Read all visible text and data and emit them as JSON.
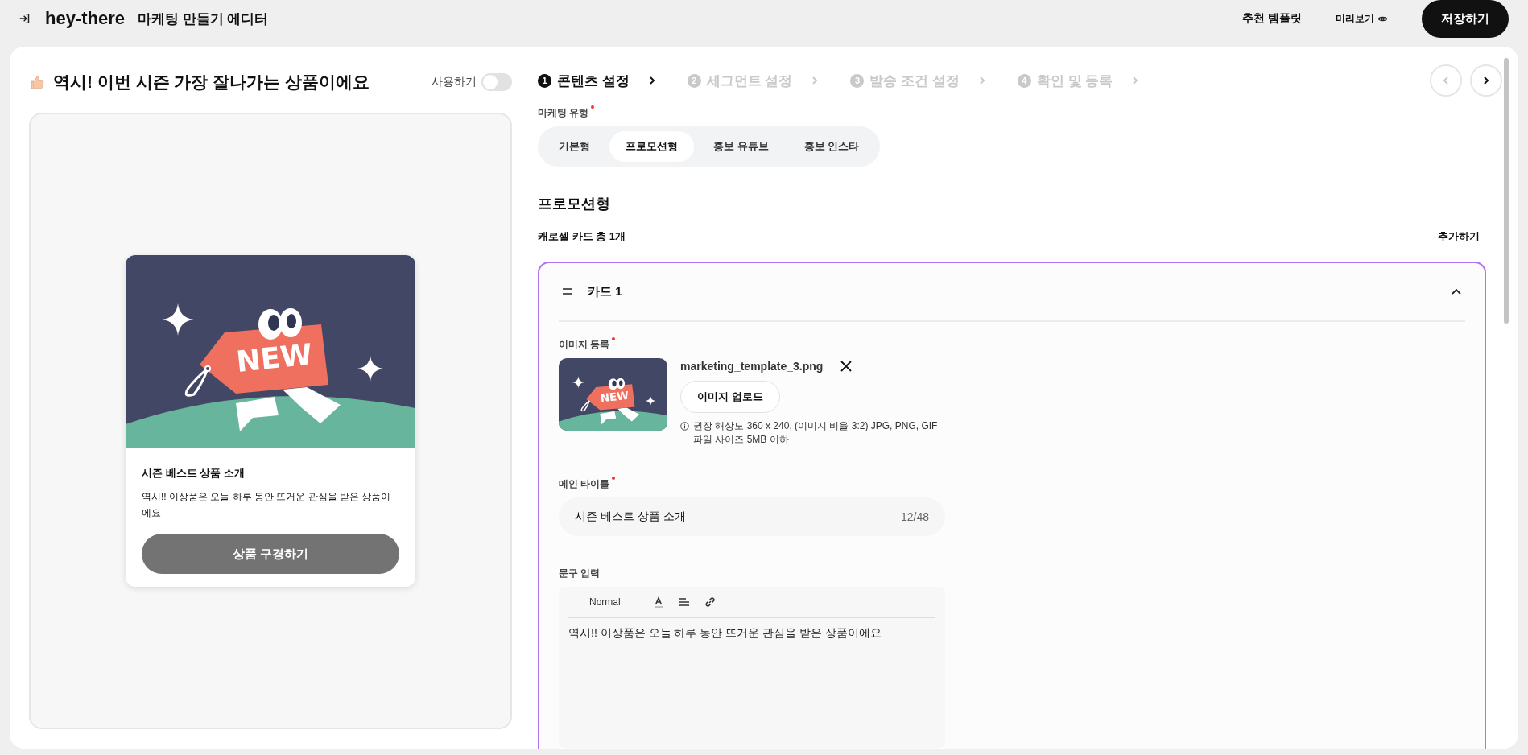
{
  "app": {
    "name": "hey-there",
    "subtitle": "마케팅 만들기 에디터"
  },
  "header_actions": {
    "templates": "추천 템플릿",
    "preview": "미리보기",
    "save": "저장하기"
  },
  "preview_panel": {
    "title": "역시! 이번 시즌 가장 잘나가는 상품이에요",
    "toggle_label": "사용하기",
    "toggle_on": false,
    "card": {
      "artwork_text": "NEW",
      "title": "시즌 베스트 상품 소개",
      "body": "역시!! 이상품은 오늘 하루 동안 뜨거운 관심을 받은 상품이에요",
      "button": "상품 구경하기"
    }
  },
  "steps": [
    {
      "number": "1",
      "label": "콘텐츠 설정",
      "selected": true
    },
    {
      "number": "2",
      "label": "세그먼트 설정",
      "selected": false
    },
    {
      "number": "3",
      "label": "발송 조건 설정",
      "selected": false
    },
    {
      "number": "4",
      "label": "확인 및 등록",
      "selected": false
    }
  ],
  "step_nav": {
    "prev_disabled": true,
    "next_disabled": false
  },
  "marketing_type": {
    "label": "마케팅 유형",
    "required": true,
    "options": [
      {
        "label": "기본형",
        "selected": false
      },
      {
        "label": "프로모션형",
        "selected": true
      },
      {
        "label": "홍보 유튜브",
        "selected": false
      },
      {
        "label": "홍보 인스타",
        "selected": false
      }
    ]
  },
  "section_title": "프로모션형",
  "carousel": {
    "count_label": "캐로셀 카드 총 1개",
    "add": "추가하기"
  },
  "card": {
    "title": "카드 1",
    "expanded": true,
    "image": {
      "label": "이미지 등록",
      "required": true,
      "thumbnail_text": "NEW",
      "filename": "marketing_template_3.png",
      "upload": "이미지 업로드",
      "hints": [
        "권장 해상도 360 x 240, (이미지 비율 3:2) JPG, PNG, GIF",
        "파일 사이즈 5MB 이하"
      ]
    },
    "main_title": {
      "label": "메인 타이틀",
      "required": true,
      "value": "시즌 베스트 상품 소개",
      "counter": "12/48"
    },
    "text": {
      "label": "문구 입력",
      "format": "Normal",
      "value": "역시!! 이상품은 오늘 하루 동안 뜨거운 관심을 받은 상품이에요"
    }
  }
}
